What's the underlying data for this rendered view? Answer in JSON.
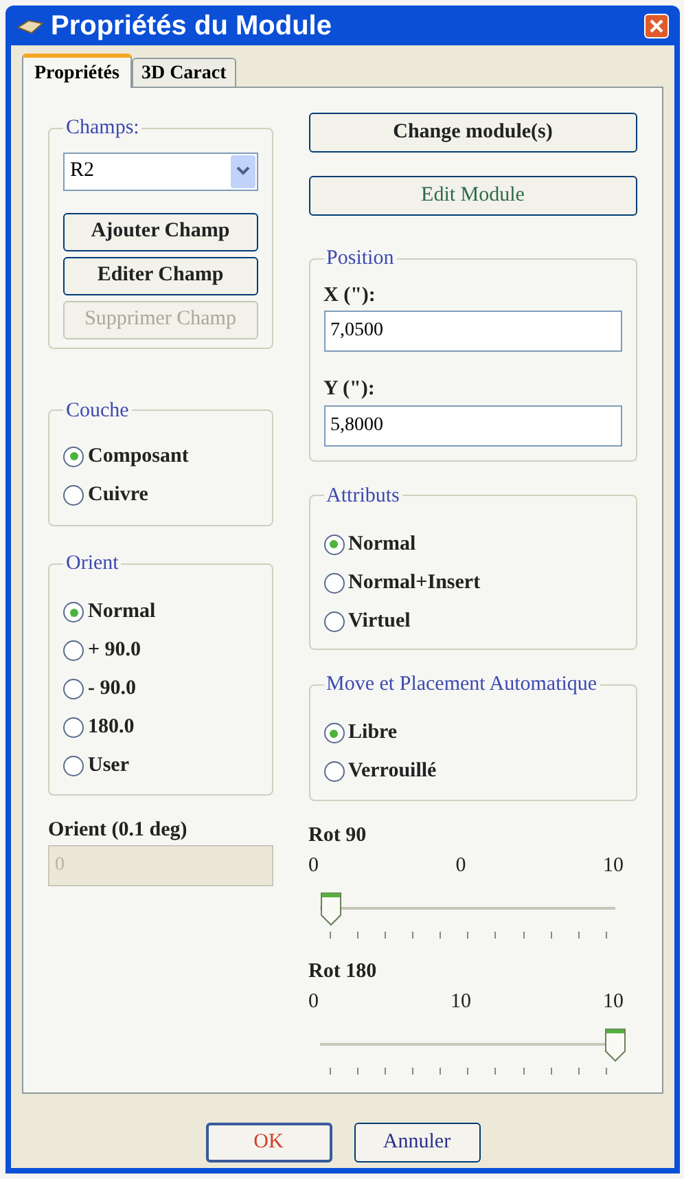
{
  "window": {
    "title": "Propriétés du Module"
  },
  "tabs": [
    {
      "label": "Propriétés",
      "selected": true
    },
    {
      "label": "3D Caract",
      "selected": false
    }
  ],
  "champs": {
    "label": "Champs:",
    "value": "R2",
    "buttons": [
      {
        "label": "Ajouter Champ",
        "disabled": false
      },
      {
        "label": "Editer Champ",
        "disabled": false
      },
      {
        "label": "Supprimer Champ",
        "disabled": true
      }
    ]
  },
  "couche": {
    "label": "Couche",
    "options": [
      {
        "label": "Composant",
        "selected": true
      },
      {
        "label": "Cuivre",
        "selected": false
      }
    ]
  },
  "orient": {
    "label": "Orient",
    "options": [
      {
        "label": "Normal",
        "selected": true
      },
      {
        "label": "+ 90.0",
        "selected": false
      },
      {
        "label": "- 90.0",
        "selected": false
      },
      {
        "label": "180.0",
        "selected": false
      },
      {
        "label": "User",
        "selected": false
      }
    ]
  },
  "orient_field": {
    "label": "Orient (0.1 deg)",
    "value": "0",
    "disabled": true
  },
  "actions": [
    {
      "label": "Change module(s)"
    },
    {
      "label": "Edit Module"
    }
  ],
  "position": {
    "label": "Position",
    "fields": [
      {
        "label": "X (\"):",
        "value": "7,0500"
      },
      {
        "label": "Y (\"):",
        "value": "5,8000"
      }
    ]
  },
  "attributs": {
    "label": "Attributs",
    "options": [
      {
        "label": "Normal",
        "selected": true
      },
      {
        "label": "Normal+Insert",
        "selected": false
      },
      {
        "label": "Virtuel",
        "selected": false
      }
    ]
  },
  "move": {
    "label": "Move et Placement Automatique",
    "options": [
      {
        "label": "Libre",
        "selected": true
      },
      {
        "label": "Verrouillé",
        "selected": false
      }
    ]
  },
  "sliders": [
    {
      "label": "Rot 90",
      "min": "0",
      "value": "0",
      "max": "10",
      "level": 0
    },
    {
      "label": "Rot 180",
      "min": "0",
      "value": "10",
      "max": "10",
      "level": 1
    }
  ],
  "buttons": [
    {
      "label": "OK",
      "default": true
    },
    {
      "label": "Annuler",
      "default": false
    }
  ]
}
